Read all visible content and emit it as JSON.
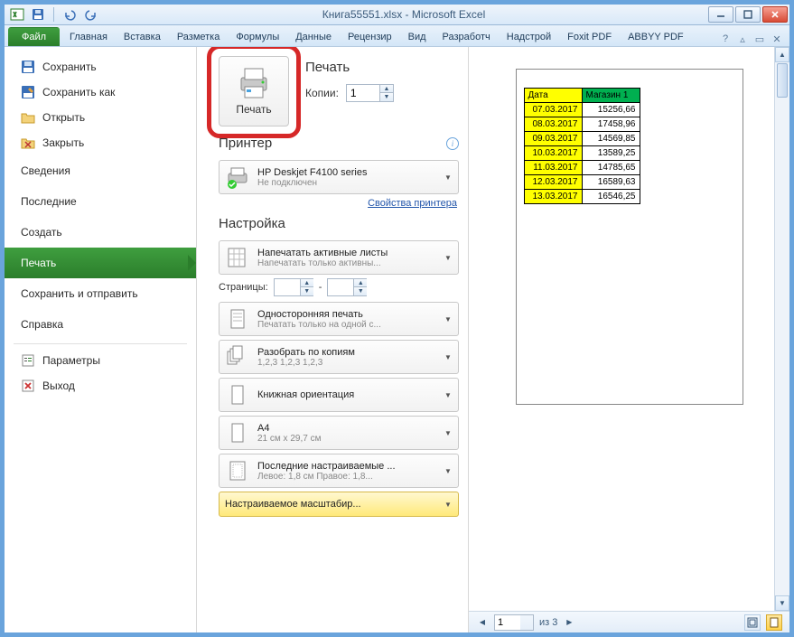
{
  "window": {
    "title": "Книга55551.xlsx - Microsoft Excel"
  },
  "ribbon": {
    "file": "Файл",
    "tabs": [
      "Главная",
      "Вставка",
      "Разметка",
      "Формулы",
      "Данные",
      "Рецензир",
      "Вид",
      "Разработч",
      "Надстрой",
      "Foxit PDF",
      "ABBYY PDF"
    ]
  },
  "menu": {
    "save": "Сохранить",
    "save_as": "Сохранить как",
    "open": "Открыть",
    "close": "Закрыть",
    "info": "Сведения",
    "recent": "Последние",
    "new": "Создать",
    "print": "Печать",
    "send": "Сохранить и отправить",
    "help": "Справка",
    "options": "Параметры",
    "exit": "Выход"
  },
  "print": {
    "title": "Печать",
    "big_button_label": "Печать",
    "copies_label": "Копии:",
    "copies_value": "1",
    "printer_section": "Принтер",
    "printer_name": "HP Deskjet F4100 series",
    "printer_status": "Не подключен",
    "printer_properties": "Свойства принтера",
    "settings_section": "Настройка",
    "active_sheets_title": "Напечатать активные листы",
    "active_sheets_sub": "Напечатать только активны...",
    "pages_label": "Страницы:",
    "pages_to": "-",
    "one_sided_title": "Односторонняя печать",
    "one_sided_sub": "Печатать только на одной с...",
    "collate_title": "Разобрать по копиям",
    "collate_sub": "1,2,3   1,2,3   1,2,3",
    "orientation_title": "Книжная ориентация",
    "paper_title": "A4",
    "paper_sub": "21 см x 29,7 см",
    "margins_title": "Последние настраиваемые ...",
    "margins_sub": "Левое: 1,8 см   Правое: 1,8...",
    "scaling_title": "Настраиваемое масштабир..."
  },
  "preview": {
    "table": {
      "headers": {
        "date": "Дата",
        "shop": "Магазин 1"
      },
      "rows": [
        {
          "date": "07.03.2017",
          "value": "15256,66"
        },
        {
          "date": "08.03.2017",
          "value": "17458,96"
        },
        {
          "date": "09.03.2017",
          "value": "14569,85"
        },
        {
          "date": "10.03.2017",
          "value": "13589,25"
        },
        {
          "date": "11.03.2017",
          "value": "14785,65"
        },
        {
          "date": "12.03.2017",
          "value": "16589,63"
        },
        {
          "date": "13.03.2017",
          "value": "16546,25"
        }
      ]
    },
    "footer": {
      "current_page": "1",
      "of_text": "из 3"
    }
  }
}
